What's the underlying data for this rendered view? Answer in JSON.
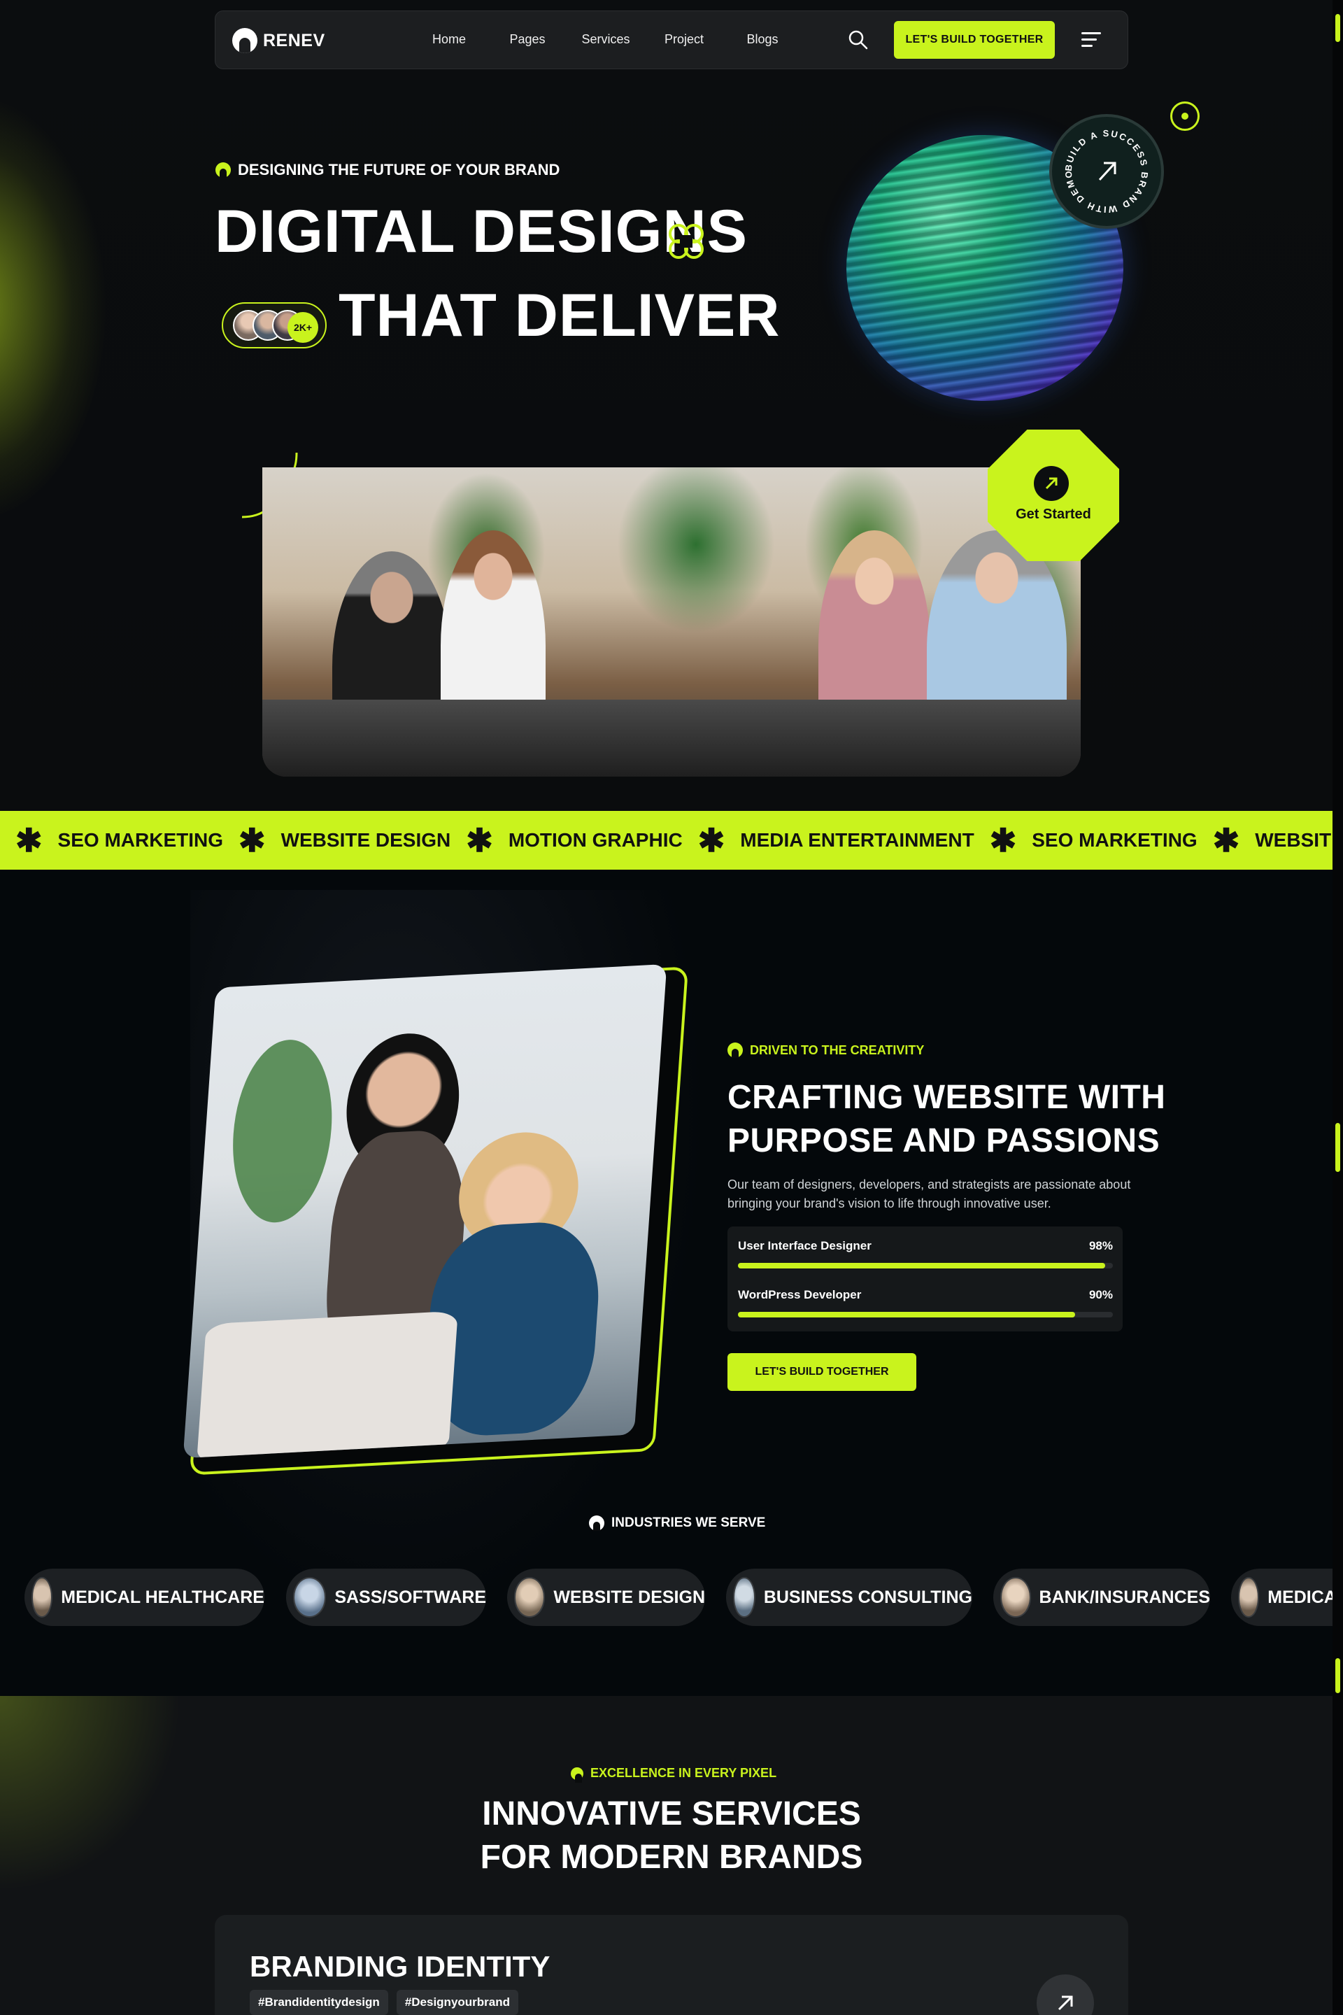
{
  "nav": {
    "logo": "RENEV",
    "links": [
      "Home",
      "Pages",
      "Services",
      "Project",
      "Blogs"
    ],
    "cta": "LET'S BUILD TOGETHER",
    "icons": [
      "search-icon",
      "menu-icon"
    ]
  },
  "hero": {
    "tag": "DESIGNING THE FUTURE OF YOUR BRAND",
    "title_line1": "DIGITAL DESIGNS",
    "title_line2": "THAT DELIVER",
    "avatar_count": "2K+",
    "badge_text": "BUILD A SUCCESS BRAND WITH DEMOUI",
    "get_started": "Get Started"
  },
  "marquee": [
    "SEO MARKETING",
    "WEBSITE DESIGN",
    "MOTION GRAPHIC",
    "MEDIA ENTERTAINMENT",
    "SEO MARKETING",
    "WEBSITE DESIGN"
  ],
  "about": {
    "tag": "DRIVEN TO THE CREATIVITY",
    "title_line1": "CRAFTING WEBSITE WITH",
    "title_line2": "PURPOSE AND PASSIONS",
    "text": "Our team of designers, developers, and strategists are passionate about bringing your brand's vision to life through innovative user.",
    "skills": [
      {
        "label": "User Interface Designer",
        "pct_text": "98%",
        "value": 98
      },
      {
        "label": "WordPress Developer",
        "pct_text": "90%",
        "value": 90
      }
    ],
    "cta": "LET'S BUILD TOGETHER"
  },
  "industries": {
    "tag": "INDUSTRIES WE SERVE",
    "items": [
      "MEDICAL HEALTHCARE",
      "SASS/SOFTWARE",
      "WEBSITE DESIGN",
      "BUSINESS CONSULTING",
      "BANK/INSURANCES",
      "MEDICAL HEALTHCARE"
    ]
  },
  "services": {
    "tag": "EXCELLENCE IN EVERY PIXEL",
    "title_line1": "INNOVATIVE SERVICES",
    "title_line2": "FOR MODERN BRANDS",
    "card_title": "BRANDING IDENTITY",
    "card_tags": [
      "#Brandidentitydesign",
      "#Designyourbrand"
    ]
  },
  "colors": {
    "accent": "#c9f31d",
    "background": "#080a0c",
    "surface": "#1c1e20"
  }
}
